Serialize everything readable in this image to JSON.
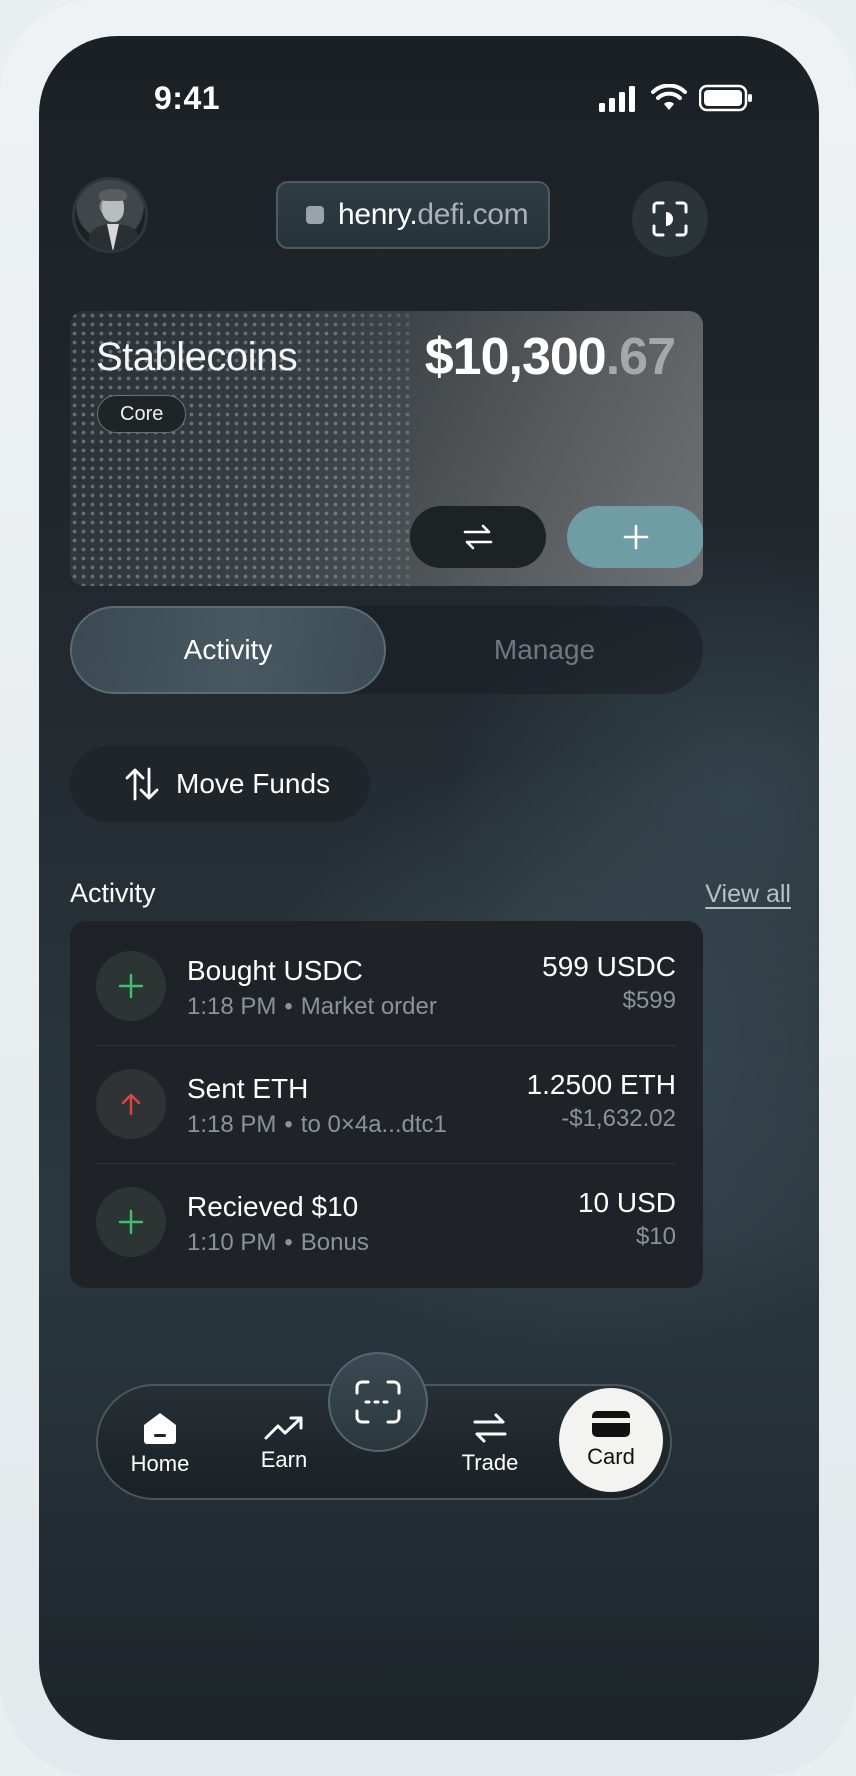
{
  "status_bar": {
    "time": "9:41"
  },
  "header": {
    "url_host": "henry.",
    "url_domain": "defi.com"
  },
  "wallet_card": {
    "title": "Stablecoins",
    "badge": "Core",
    "balance_main": "$10,300",
    "balance_cents": ".67"
  },
  "tabs": {
    "active": "Activity",
    "inactive": "Manage"
  },
  "move_funds": {
    "label": "Move Funds"
  },
  "activity": {
    "heading": "Activity",
    "view_all": "View all",
    "items": [
      {
        "title": "Bought USDC",
        "time": "1:18 PM",
        "detail": "Market order",
        "amount": "599 USDC",
        "fiat": "$599",
        "icon": "plus-icon",
        "color": "#3fbf6f"
      },
      {
        "title": "Sent ETH",
        "time": "1:18 PM",
        "detail": "to 0×4a...dtc1",
        "amount": "1.2500 ETH",
        "fiat": "-$1,632.02",
        "icon": "arrow-up-icon",
        "color": "#e0443e"
      },
      {
        "title": "Recieved $10",
        "time": "1:10 PM",
        "detail": "Bonus",
        "amount": "10 USD",
        "fiat": "$10",
        "icon": "plus-icon",
        "color": "#3fbf6f"
      }
    ]
  },
  "tab_bar": {
    "home": "Home",
    "earn": "Earn",
    "trade": "Trade",
    "card": "Card"
  },
  "colors": {
    "accent": "#6f9da6",
    "positive": "#3fbf6f",
    "negative": "#e0443e"
  }
}
